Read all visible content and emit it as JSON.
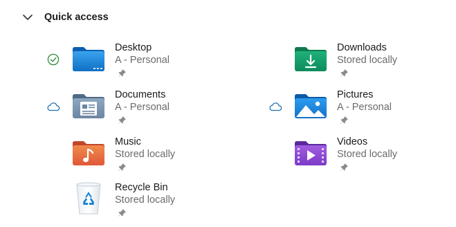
{
  "section": {
    "title": "Quick access"
  },
  "items": [
    {
      "name": "Desktop",
      "subtitle": "A - Personal",
      "status": "synced-check-icon"
    },
    {
      "name": "Downloads",
      "subtitle": "Stored locally",
      "status": ""
    },
    {
      "name": "Documents",
      "subtitle": "A - Personal",
      "status": "cloud-icon"
    },
    {
      "name": "Pictures",
      "subtitle": "A - Personal",
      "status": "cloud-icon"
    },
    {
      "name": "Music",
      "subtitle": "Stored locally",
      "status": ""
    },
    {
      "name": "Videos",
      "subtitle": "Stored locally",
      "status": ""
    },
    {
      "name": "Recycle Bin",
      "subtitle": "Stored locally",
      "status": ""
    }
  ],
  "colors": {
    "synced_green": "#2e8b3d",
    "cloud_blue": "#1f6fb2",
    "pin_gray": "#8a8a8a"
  }
}
